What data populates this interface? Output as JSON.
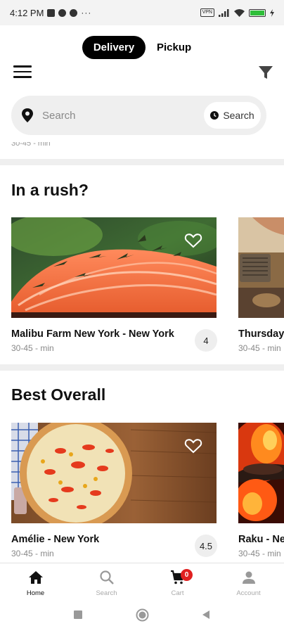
{
  "status_bar": {
    "time": "4:12 PM",
    "vpn": "VPN",
    "battery_icon": "battery-icon"
  },
  "header": {
    "modes": [
      "Delivery",
      "Pickup"
    ],
    "selected_mode": "Delivery",
    "menu_icon": "hamburger-menu-icon",
    "filter_icon": "filter-funnel-icon"
  },
  "search": {
    "placeholder": "Search",
    "button_label": "Search",
    "location_icon": "location-pin-icon",
    "schedule_icon": "clock-icon"
  },
  "peek_text": "30-45 - min",
  "sections": [
    {
      "title": "In a rush?",
      "cards": [
        {
          "name": "Malibu Farm New York - New York",
          "eta": "30-45 - min",
          "rating": "4",
          "image": "salmon-fillet-photo"
        },
        {
          "name": "Thursday Kitchen - New York",
          "eta": "30-45 - min",
          "image": "kitchen-photo"
        }
      ]
    },
    {
      "title": "Best Overall",
      "cards": [
        {
          "name": "Amélie - New York",
          "eta": "30-45 - min",
          "rating": "4.5",
          "image": "pizza-photo"
        },
        {
          "name": "Raku - New York",
          "eta": "30-45 - min",
          "image": "grill-fire-photo"
        }
      ]
    }
  ],
  "bottom_nav": {
    "items": [
      {
        "label": "Home",
        "icon": "home-icon"
      },
      {
        "label": "Search",
        "icon": "search-icon"
      },
      {
        "label": "Cart",
        "icon": "cart-icon",
        "badge": "0"
      },
      {
        "label": "Account",
        "icon": "account-icon"
      }
    ],
    "active": "Home"
  },
  "colors": {
    "accent": "#000000",
    "badge": "#e02020",
    "surface": "#efefef"
  }
}
